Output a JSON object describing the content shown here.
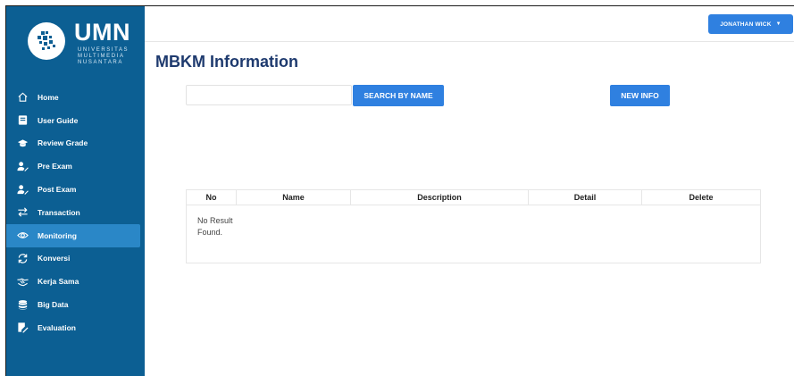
{
  "brand": {
    "name": "UMN",
    "line1": "UNIVERSITAS",
    "line2": "MULTIMEDIA",
    "line3": "NUSANTARA"
  },
  "sidebar": {
    "items": [
      {
        "label": "Home",
        "icon": "home-icon",
        "active": false
      },
      {
        "label": "User Guide",
        "icon": "book-icon",
        "active": false
      },
      {
        "label": "Review Grade",
        "icon": "graduation-cap-icon",
        "active": false
      },
      {
        "label": "Pre Exam",
        "icon": "user-edit-icon",
        "active": false
      },
      {
        "label": "Post Exam",
        "icon": "user-edit-icon",
        "active": false
      },
      {
        "label": "Transaction",
        "icon": "exchange-icon",
        "active": false
      },
      {
        "label": "Monitoring",
        "icon": "eye-icon",
        "active": true
      },
      {
        "label": "Konversi",
        "icon": "sync-icon",
        "active": false
      },
      {
        "label": "Kerja Sama",
        "icon": "handshake-icon",
        "active": false
      },
      {
        "label": "Big Data",
        "icon": "database-icon",
        "active": false
      },
      {
        "label": "Evaluation",
        "icon": "clipboard-edit-icon",
        "active": false
      }
    ]
  },
  "header": {
    "user_label": "JONATHAN WICK",
    "caret": "▼"
  },
  "main": {
    "title": "MBKM Information",
    "search": {
      "value": "",
      "placeholder": ""
    },
    "search_button": "SEARCH BY NAME",
    "new_button": "NEW INFO",
    "table": {
      "columns": [
        "No",
        "Name",
        "Description",
        "Detail",
        "Delete"
      ],
      "empty_message": "No Result Found."
    }
  },
  "colors": {
    "sidebar_bg": "#0c5f93",
    "sidebar_active": "#2a87c7",
    "primary_button": "#2f80e0",
    "title": "#1e3a6e"
  }
}
